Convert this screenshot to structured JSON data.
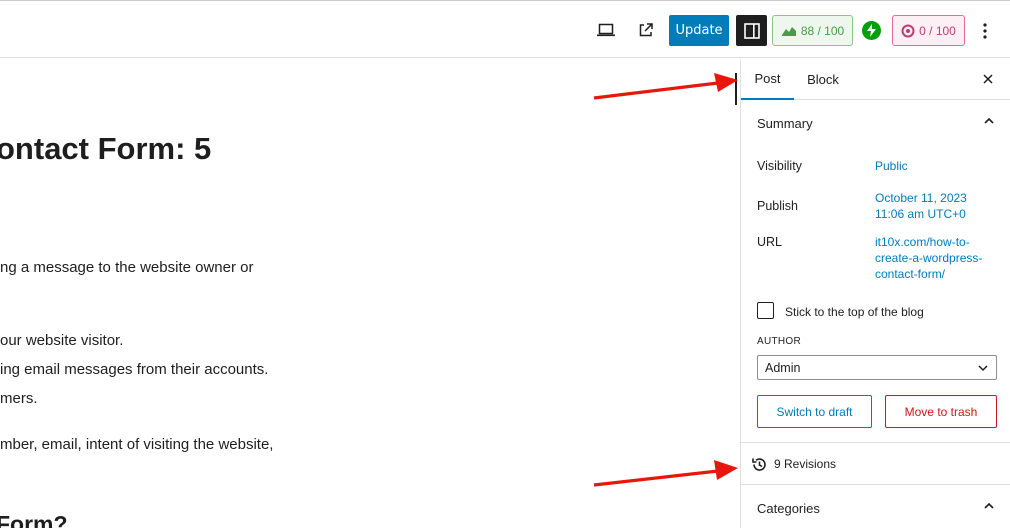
{
  "toolbar": {
    "preview_icon": "laptop-icon",
    "view_post_icon": "external-link-icon",
    "update_label": "Update",
    "settings_icon": "sidebar-toggle-icon",
    "seo_score": "88 / 100",
    "seo_icon": "seo-icon",
    "jetpack_icon": "jetpack-icon",
    "readability_score": "0 / 100",
    "readability_icon": "readability-icon",
    "options_icon": "kebab-menu-icon",
    "colors": {
      "primary": "#007cba",
      "seo_green": "#4c9a4c",
      "readability_pink": "#c03c74",
      "jetpack_green": "#069e08"
    }
  },
  "editor": {
    "heading": "ontact Form: 5",
    "paragraphs": [
      "ng a message to the website owner or",
      "our website visitor.",
      "ing email messages from their accounts.",
      "mers.",
      "mber, email, intent of visiting the website,"
    ],
    "subheading": "Form?"
  },
  "sidebar": {
    "tabs": [
      "Post",
      "Block"
    ],
    "active_tab": "Post",
    "summary": {
      "title": "Summary",
      "visibility_label": "Visibility",
      "visibility_value": "Public",
      "publish_label": "Publish",
      "publish_value_line1": "October 11, 2023",
      "publish_value_line2": "11:06 am UTC+0",
      "url_label": "URL",
      "url_line1": "it10x.com/how-to-",
      "url_line2": "create-a-wordpress-",
      "url_line3": "contact-form/",
      "sticky_label": "Stick to the top of the blog",
      "author_label": "AUTHOR",
      "author_value": "Admin",
      "switch_draft_label": "Switch to draft",
      "trash_label": "Move to trash"
    },
    "revisions_label": "9 Revisions",
    "categories_title": "Categories"
  }
}
